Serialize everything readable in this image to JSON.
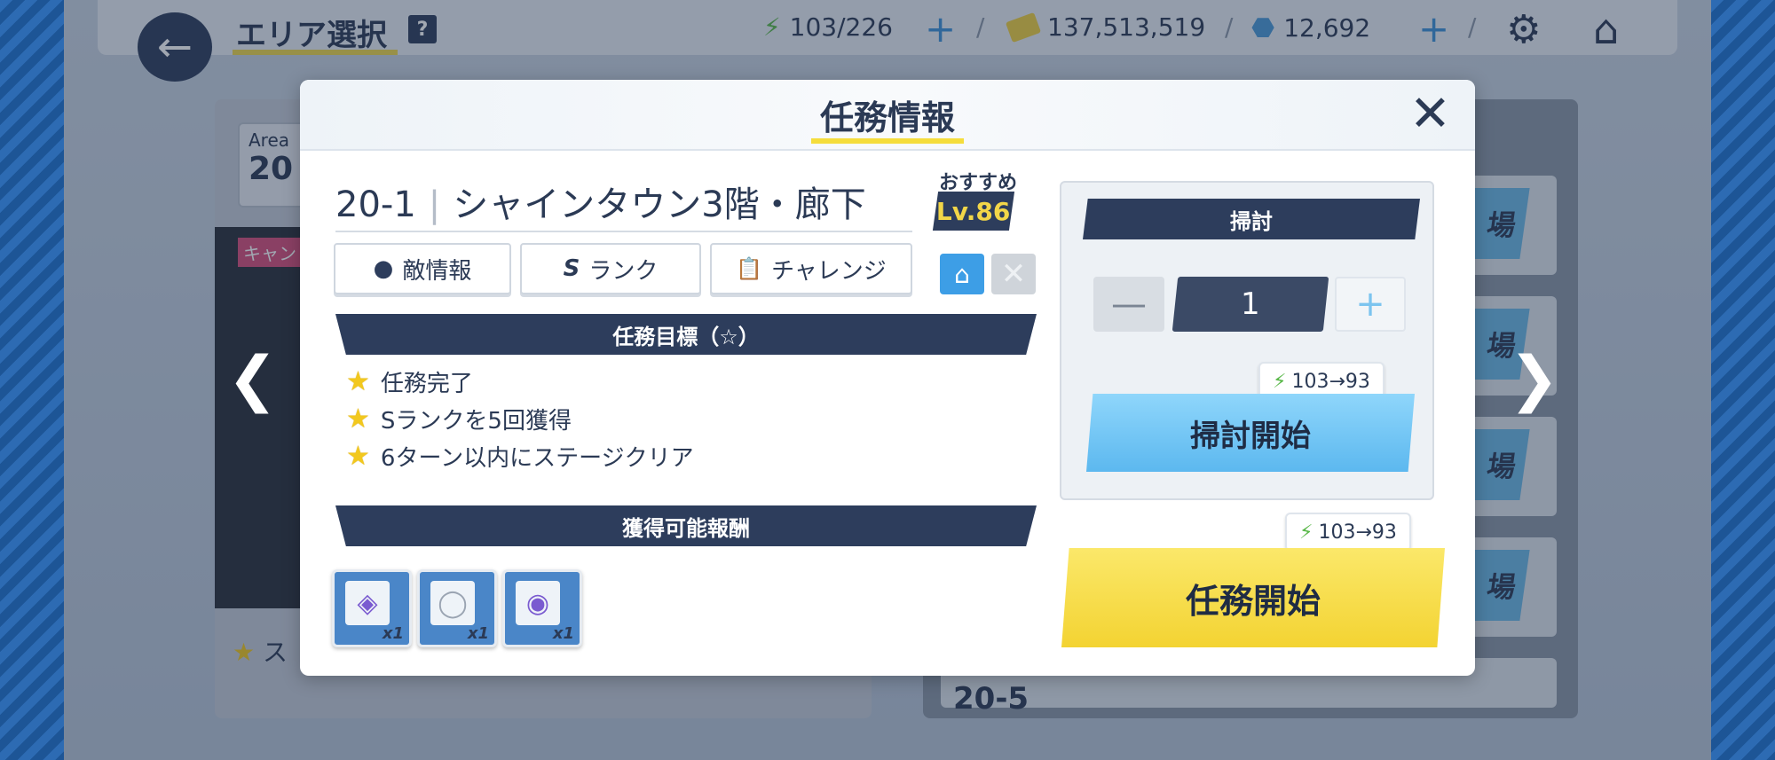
{
  "header": {
    "title": "エリア選択",
    "help": "?",
    "ap": "103/226",
    "credits": "137,513,519",
    "gems": "12,692"
  },
  "background": {
    "area_label": "Area",
    "area_number": "20",
    "banner_text": "キャン",
    "stage_text": "ス",
    "row5_number": "20-5",
    "row_button_suffix": "場"
  },
  "modal": {
    "title": "任務情報",
    "stage_id": "20-1",
    "stage_name": "シャインタウン3階・廊下",
    "recommend_label": "おすすめ",
    "recommend_level": "Lv.86",
    "tabs": [
      {
        "label": "敵情報",
        "icon": "chat-bubble-icon"
      },
      {
        "label": "ランク",
        "icon": "s-rank-icon",
        "prefix": "S"
      },
      {
        "label": "チャレンジ",
        "icon": "clipboard-icon"
      }
    ],
    "objectives_title": "任務目標（☆）",
    "objectives": [
      "任務完了",
      "Sランクを5回獲得",
      "6ターン以内にステージクリア"
    ],
    "rewards_title": "獲得可能報酬",
    "rewards": [
      {
        "qty": "x1",
        "icon": "bottle-icon"
      },
      {
        "qty": "x1",
        "icon": "ring-icon"
      },
      {
        "qty": "x1",
        "icon": "disc-icon"
      }
    ],
    "sweep": {
      "label": "掃討",
      "quantity": "1",
      "ap_cost": "103→93",
      "button": "掃討開始"
    },
    "start": {
      "ap_cost": "103→93",
      "button": "任務開始"
    }
  },
  "colors": {
    "navy": "#2d3d5c",
    "accent_yellow": "#f3d332",
    "accent_blue": "#5cb8ef"
  }
}
